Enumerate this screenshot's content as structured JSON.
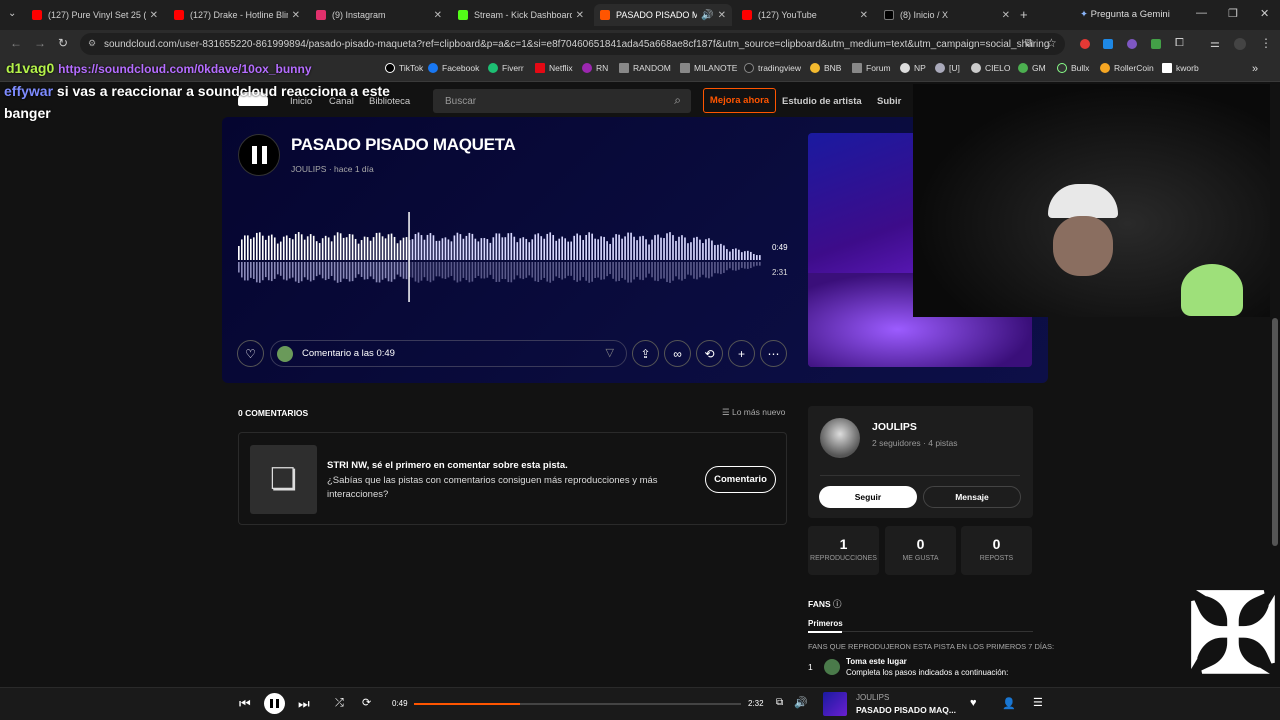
{
  "browser": {
    "tabs": [
      {
        "title": "(127) Pure Vinyl Set 25 (Cl...",
        "color": "#ff0000"
      },
      {
        "title": "(127) Drake - Hotline Bling",
        "color": "#ff0000"
      },
      {
        "title": "(9) Instagram",
        "color": "#e1306c"
      },
      {
        "title": "Stream - Kick Dashboard",
        "color": "#53fc18"
      },
      {
        "title": "PASADO PISADO MAQ...",
        "color": "#ff5500"
      },
      {
        "title": "(127) YouTube",
        "color": "#ff0000"
      },
      {
        "title": "(8) Inicio / X",
        "color": "#000000"
      }
    ],
    "gemini": "Pregunta a Gemini",
    "url": "soundcloud.com/user-831655220-861999894/pasado-pisado-maqueta?ref=clipboard&p=a&c=1&si=e8f70460651841ada45a668ae8cf187f&utm_source=clipboard&utm_medium=text&utm_campaign=social_sharing",
    "bookmarks": [
      "TikTok",
      "Facebook",
      "Fiverr",
      "Netflix",
      "RN",
      "RANDOM",
      "MILANOTE",
      "tradingview",
      "BNB",
      "Forum",
      "NP",
      "[U]",
      "CIELO",
      "GM",
      "Bullx",
      "RollerCoin",
      "kworb"
    ]
  },
  "chat": {
    "line1_user": "d1vag0",
    "line1_text": "https://soundcloud.com/0kdave/10ox_bunny",
    "line2_user": "effywar",
    "line2_text": "si vas a reaccionar a soundcloud reacciona a este",
    "line3_text": "banger"
  },
  "header": {
    "nav": [
      "Inicio",
      "Canal",
      "Biblioteca"
    ],
    "search_placeholder": "Buscar",
    "upgrade": "Mejora ahora",
    "studio": "Estudio de artista",
    "upload": "Subir"
  },
  "track": {
    "title": "PASADO PISADO MAQUETA",
    "artist": "JOULIPS",
    "sep": "·",
    "ago": "hace 1 día",
    "elapsed": "0:49",
    "duration": "2:31",
    "comment_placeholder": "Comentario a las 0:49",
    "progress": 0.325
  },
  "comments": {
    "count_label": "0 COMENTARIOS",
    "sort": "Lo más nuevo",
    "prompt_title": "STRI NW, sé el primero en comentar sobre esta pista.",
    "prompt_body": "¿Sabías que las pistas con comentarios consiguen más reproducciones y más interacciones?",
    "button": "Comentario"
  },
  "artist_card": {
    "name": "JOULIPS",
    "meta": "2 seguidores · 4 pistas",
    "follow": "Seguir",
    "message": "Mensaje"
  },
  "stats": [
    {
      "value": "1",
      "label": "REPRODUCCIONES"
    },
    {
      "value": "0",
      "label": "ME GUSTA"
    },
    {
      "value": "0",
      "label": "REPOSTS"
    }
  ],
  "fans": {
    "title": "FANS",
    "tab": "Primeros",
    "desc": "FANS QUE REPRODUJERON ESTA PISTA EN LOS PRIMEROS 7 DÍAS:",
    "rank": "1",
    "item_title": "Toma este lugar",
    "item_sub": "Completa los pasos indicados a continuación:"
  },
  "player": {
    "elapsed": "0:49",
    "duration": "2:32",
    "artist": "JOULIPS",
    "title": "PASADO PISADO MAQ...",
    "progress": 0.325
  }
}
